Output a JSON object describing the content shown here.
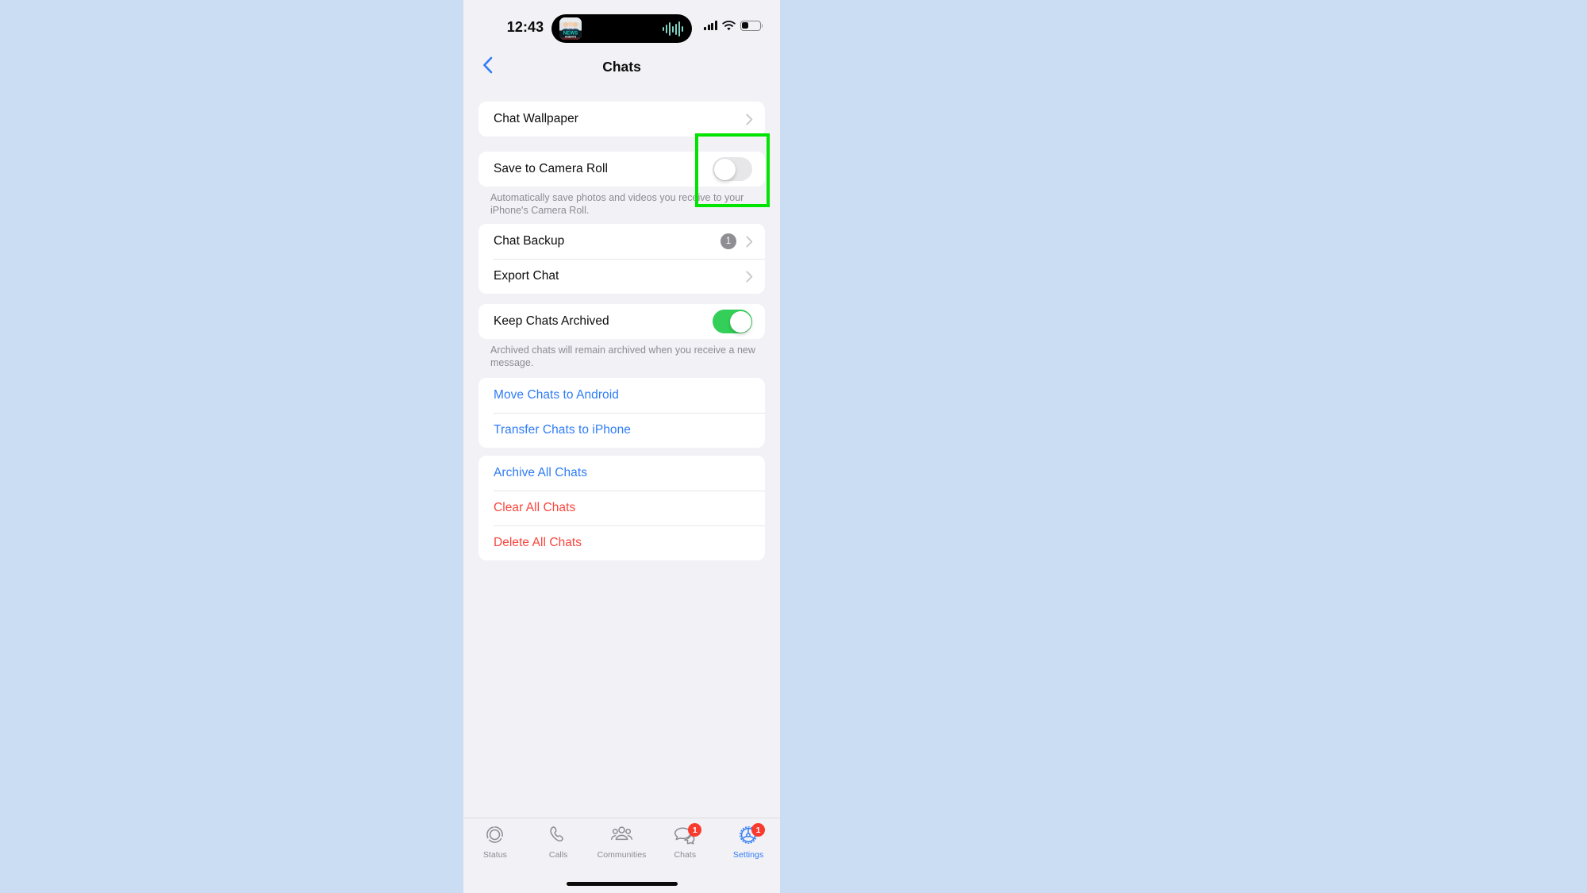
{
  "backdrop_color": "#cbddf2",
  "device": {
    "screen_bg": "#f2f1f6",
    "status_bar": {
      "time": "12:43",
      "dynamic_island": {
        "app_icon_name": "news-agents-app-icon",
        "activity": "audio-waveform"
      },
      "cellular_icon": "cellular-signal-icon",
      "cellular_bars": 4,
      "wifi_icon": "wifi-icon",
      "battery_icon": "battery-icon",
      "battery_level_pct": 30
    },
    "home_indicator": true
  },
  "navbar": {
    "back_icon": "chevron-left-icon",
    "title": "Chats"
  },
  "groups": [
    {
      "id": "wallpaper",
      "rows": [
        {
          "label": "Chat Wallpaper",
          "type": "disclosure",
          "accessory_icon": "chevron-right-icon"
        }
      ]
    },
    {
      "id": "camera-roll",
      "rows": [
        {
          "label": "Save to Camera Roll",
          "type": "toggle",
          "toggle_state": "off"
        }
      ],
      "footnote": "Automatically save photos and videos you receive to your iPhone's Camera Roll."
    },
    {
      "id": "backup",
      "rows": [
        {
          "label": "Chat Backup",
          "type": "disclosure",
          "badge": "1",
          "badge_color": "#8e8e93",
          "accessory_icon": "chevron-right-icon"
        },
        {
          "label": "Export Chat",
          "type": "disclosure",
          "accessory_icon": "chevron-right-icon"
        }
      ]
    },
    {
      "id": "archive",
      "rows": [
        {
          "label": "Keep Chats Archived",
          "type": "toggle",
          "toggle_state": "on",
          "toggle_color": "#33cf58"
        }
      ],
      "footnote": "Archived chats will remain archived when you receive a new message."
    },
    {
      "id": "transfer",
      "rows": [
        {
          "label": "Move Chats to Android",
          "type": "action",
          "style": "blue"
        },
        {
          "label": "Transfer Chats to iPhone",
          "type": "action",
          "style": "blue"
        }
      ]
    },
    {
      "id": "bulk-actions",
      "rows": [
        {
          "label": "Archive All Chats",
          "type": "action",
          "style": "blue"
        },
        {
          "label": "Clear All Chats",
          "type": "action",
          "style": "red"
        },
        {
          "label": "Delete All Chats",
          "type": "action",
          "style": "red"
        }
      ]
    }
  ],
  "tabbar": {
    "active": "Settings",
    "tabs": [
      {
        "label": "Status",
        "icon": "status-rings-icon",
        "badge": null
      },
      {
        "label": "Calls",
        "icon": "phone-icon",
        "badge": null
      },
      {
        "label": "Communities",
        "icon": "communities-people-icon",
        "badge": null
      },
      {
        "label": "Chats",
        "icon": "chat-bubbles-icon",
        "badge": "1"
      },
      {
        "label": "Settings",
        "icon": "gear-icon",
        "badge": "1"
      }
    ],
    "inactive_color": "#8b8b91",
    "active_color": "#2f7cf6",
    "badge_color": "#f93a2f"
  },
  "annotation": {
    "highlight_color": "#00e400",
    "target": "save-to-camera-roll-toggle"
  }
}
